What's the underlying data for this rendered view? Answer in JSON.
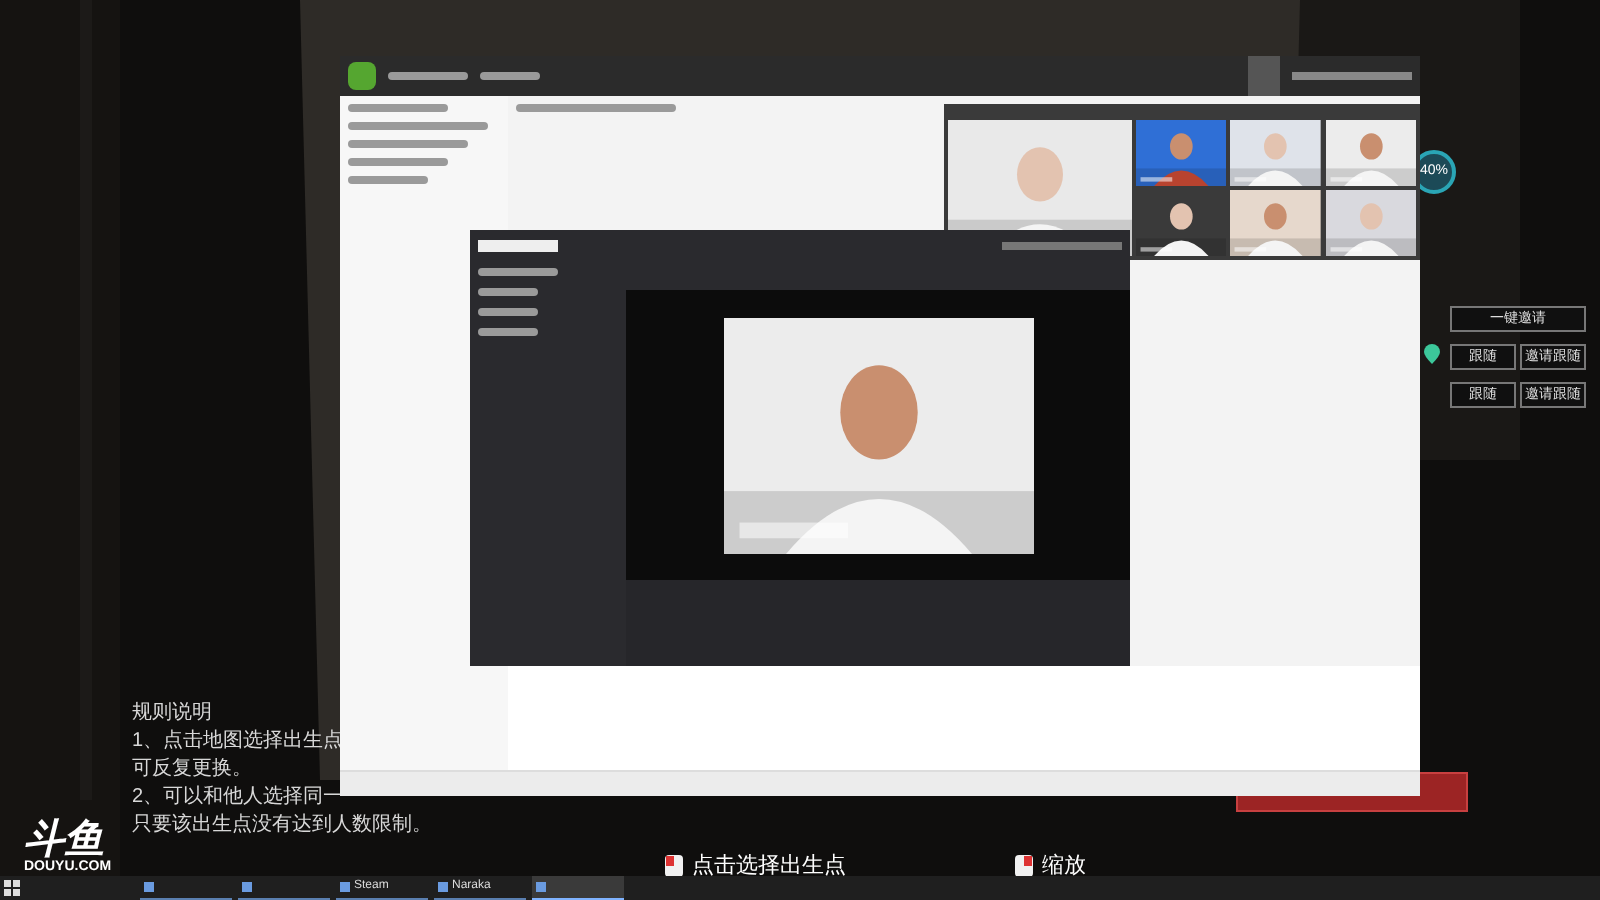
{
  "rules": {
    "title": "规则说明",
    "lines": [
      "1、点击地图选择出生点",
      "可反复更换。",
      "2、可以和他人选择同一",
      "只要该出生点没有达到人数限制。"
    ]
  },
  "logo": {
    "mark": "斗鱼",
    "text": "DOUYU.COM"
  },
  "hints": [
    {
      "label": "点击选择出生点"
    },
    {
      "label": "缩放"
    }
  ],
  "team_buttons": [
    {
      "label": "一键邀请",
      "kind": "wide"
    },
    {
      "label": "跟随",
      "kind": "half"
    },
    {
      "label": "邀请跟随",
      "kind": "half"
    },
    {
      "label": "跟随",
      "kind": "half"
    },
    {
      "label": "邀请跟随",
      "kind": "half"
    }
  ],
  "progress": {
    "label": "40%"
  },
  "taskbar": {
    "items": [
      {
        "selected": false
      },
      {
        "selected": false
      },
      {
        "label": "Steam",
        "selected": false
      },
      {
        "label": "Naraka",
        "selected": false
      },
      {
        "selected": true
      }
    ]
  }
}
